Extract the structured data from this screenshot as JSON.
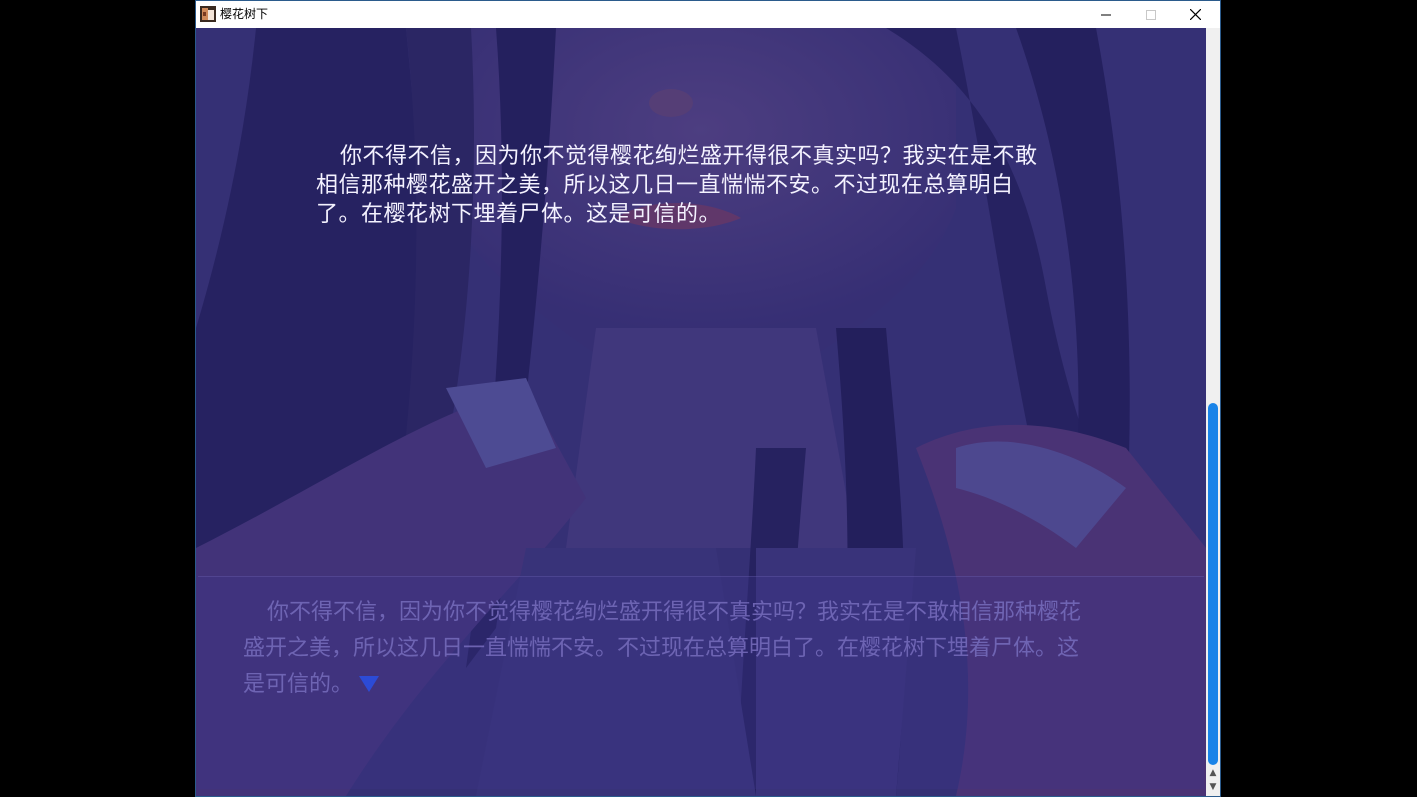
{
  "window": {
    "title": "樱花树下",
    "minimize_icon": "minimize-icon",
    "maximize_icon": "maximize-icon",
    "close_icon": "close-icon"
  },
  "story": {
    "text": "你不得不信，因为你不觉得樱花绚烂盛开得很不真实吗？我实在是不敢相信那种樱花盛开之美，所以这几日一直惴惴不安。不过现在总算明白了。在樱花树下埋着尸体。这是可信的。"
  },
  "message_window": {
    "text": "你不得不信，因为你不觉得樱花绚烂盛开得很不真实吗？我实在是不敢相信那种樱花盛开之美，所以这几日一直惴惴不安。不过现在总算明白了。在樱花树下埋着尸体。这是可信的。",
    "continue_icon": "next-arrow-icon"
  },
  "scrollbar": {
    "up_glyph": "▲",
    "down_glyph": "▼"
  },
  "colors": {
    "overlay": "#2e2b66",
    "scroll_thumb": "#1a84e8",
    "next_arrow": "#2c4bd6"
  }
}
